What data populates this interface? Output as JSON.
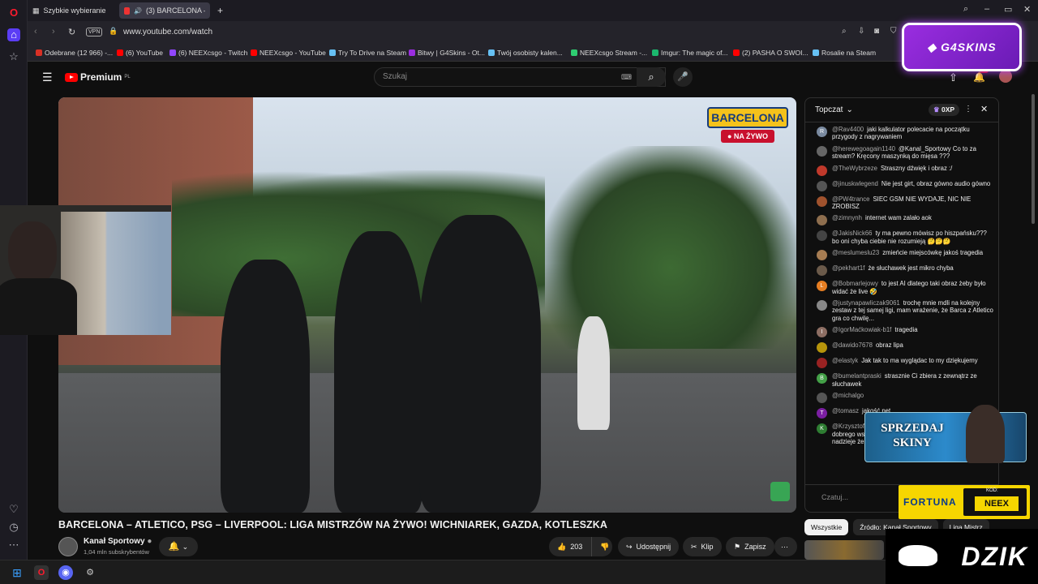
{
  "browser": {
    "tabs": [
      {
        "label": "Szybkie wybieranie"
      },
      {
        "label": "(3) BARCELONA – ATL"
      }
    ],
    "url": "www.youtube.com/watch",
    "vpn_label": "VPN",
    "ai_label": "AI",
    "bookmarks": [
      {
        "label": "Odebrane (12 966) -...",
        "color": "#d93025"
      },
      {
        "label": "(6) YouTube",
        "color": "#ff0000"
      },
      {
        "label": "(6) NEEXcsgo - Twitch",
        "color": "#9146ff"
      },
      {
        "label": "NEEXcsgo - YouTube",
        "color": "#ff0000"
      },
      {
        "label": "Try To Drive na Steam",
        "color": "#66c0f4"
      },
      {
        "label": "Bitwy | G4Skins - Ot...",
        "color": "#9a2de0"
      },
      {
        "label": "Twój osobisty kalen...",
        "color": "#66c0f4"
      },
      {
        "label": "NEEXcsgo Stream -...",
        "color": "#2ecc71"
      },
      {
        "label": "Imgur: The magic of...",
        "color": "#1bb76e"
      },
      {
        "label": "(2) PASHA O SWOI...",
        "color": "#ff0000"
      },
      {
        "label": "Rosalie na Steam",
        "color": "#66c0f4"
      }
    ]
  },
  "youtube": {
    "brand": "Premium",
    "brand_suffix": "PL",
    "search_placeholder": "Szukaj",
    "notification_count": "9+"
  },
  "video": {
    "overlay_title": "BARCELONA",
    "overlay_live": "● NA ŻYWO",
    "title": "BARCELONA – ATLETICO, PSG – LIVERPOOL: LIGA MISTRZÓW NA ŻYWO! WICHNIAREK, GAZDA, KOTLESZKA",
    "channel": "Kanał Sportowy",
    "subscribers": "1,04 mln subskrybentów",
    "likes": "203",
    "share_label": "Udostępnij",
    "clip_label": "Klip",
    "save_label": "Zapisz"
  },
  "chat": {
    "mode": "Topczat",
    "xp": "0XP",
    "input_placeholder": "Czatuj...",
    "messages": [
      {
        "author": "@Rav4400",
        "text": "jaki kalkulator polecacie na początku przygody z nagrywaniem",
        "color": "#7a8aa0"
      },
      {
        "author": "@herewegoagain1140",
        "text": "@Kanal_Sportowy Co to za stream? Kręcony maszynką do mięsa ???",
        "color": "#666"
      },
      {
        "author": "@TheWybrzeze",
        "text": "Straszny dźwięk i obraz :/",
        "color": "#c0392b"
      },
      {
        "author": "@jinuskwlegend",
        "text": "Nie jest girt, obraz gówno audio gówno",
        "color": "#555"
      },
      {
        "author": "@PW4trance",
        "text": "SIEC GSM NIE WYDAJE, NIC NIE ZROBISZ",
        "color": "#a0522d"
      },
      {
        "author": "@zimnynh",
        "text": "internet wam zalało aok",
        "color": "#8e6e4e"
      },
      {
        "author": "@JakisNick66",
        "text": "ty ma pewno mówisz po hiszpańsku??? bo oni chyba ciebie nie rozumieją 🤔🤔🤔",
        "color": "#444"
      },
      {
        "author": "@meslumeslu23",
        "text": "zmieńcie miejscówkę jakoś tragedia",
        "color": "#a67c52"
      },
      {
        "author": "@pekhart1f",
        "text": "że słuchawek jest mikro chyba",
        "color": "#6b5a4a"
      },
      {
        "author": "@Bobmarlejowy",
        "text": "to jest AI dlatego taki obraz żeby było widać że live 🤣",
        "color": "#e67e22"
      },
      {
        "author": "@justynapawliczak9061",
        "text": "trochę mnie mdli na kolejny zestaw z tej samej ligi, mam wrażenie, że Barca z Atletico gra co chwilę...",
        "color": "#888"
      },
      {
        "author": "@IgorMaćkowiak-b1f",
        "text": "tragedia",
        "color": "#8d6e63"
      },
      {
        "author": "@dawido7678",
        "text": "obraz lipa",
        "color": "#b7950b"
      },
      {
        "author": "@elastyk",
        "text": "Jak tak to ma wyglądac to my dziękujemy",
        "color": "#922"
      },
      {
        "author": "@bumelantpraski",
        "text": "strasznie Ci zbiera z zewnątrz ze słuchawek",
        "color": "#43a047"
      },
      {
        "author": "@michalgo",
        "text": "",
        "color": "#555"
      },
      {
        "author": "@tomasz",
        "text": "jakość net",
        "color": "#7b1fa2"
      },
      {
        "author": "@Krzysztof-636",
        "text": "oj ale trafiłem nie życzę tarsie niczego dobrego wstyd mi że polak gra w tym klubie mam nadzieje że w dwumeczu przegrają nq",
        "color": "#2e7d32"
      }
    ],
    "avatar_letters": [
      "R",
      "",
      "",
      "",
      "",
      "",
      "",
      "",
      "",
      "L",
      "",
      "I",
      "",
      "",
      "B",
      "",
      "T",
      "K"
    ]
  },
  "chips": [
    "Wszystkie",
    "Źródło: Kanał Sportowy",
    "Liga Mistrz"
  ],
  "ads": {
    "g4skins": "G4SKINS",
    "sprzedaj": "SPRZEDAJ SKINY",
    "fortuna": "FORTUNA",
    "fortuna_kod": "KOD:",
    "fortuna_code": "NEEX",
    "dzik": "DZIK"
  }
}
